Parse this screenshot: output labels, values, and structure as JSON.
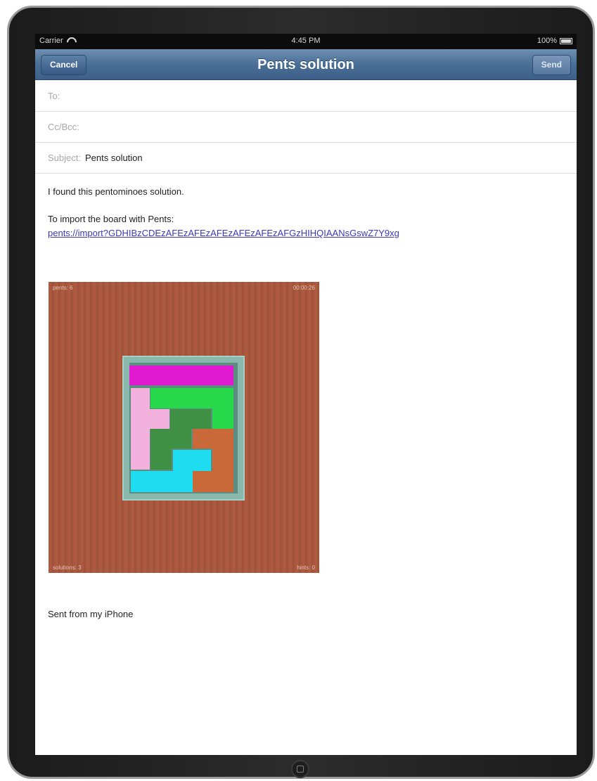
{
  "status_bar": {
    "carrier": "Carrier",
    "time": "4:45 PM",
    "battery": "100%"
  },
  "nav": {
    "title": "Pents solution",
    "cancel_label": "Cancel",
    "send_label": "Send"
  },
  "fields": {
    "to_label": "To:",
    "to_value": "",
    "cc_label": "Cc/Bcc:",
    "subject_label": "Subject:",
    "subject_value": "Pents solution"
  },
  "message": {
    "line1": "I found this pentominoes solution.",
    "line2": "To import the board with Pents:",
    "link": "pents://import?GDHIBzCDEzAFEzAFEzAFEzAFEzAFEzAFGzHIHQIAANsGswZ7Y9xg",
    "signature": "Sent from my iPhone"
  },
  "board": {
    "top_left": "pents: 6",
    "top_right": "00:00:26",
    "bottom_left": "solutions: 3",
    "bottom_right": "hints: 0"
  },
  "colors": {
    "magenta": "#e01ad0",
    "green": "#27d84a",
    "pink": "#f3b1de",
    "dark_green": "#3f8f45",
    "orange": "#c9693a",
    "cyan": "#1fdcf0"
  }
}
